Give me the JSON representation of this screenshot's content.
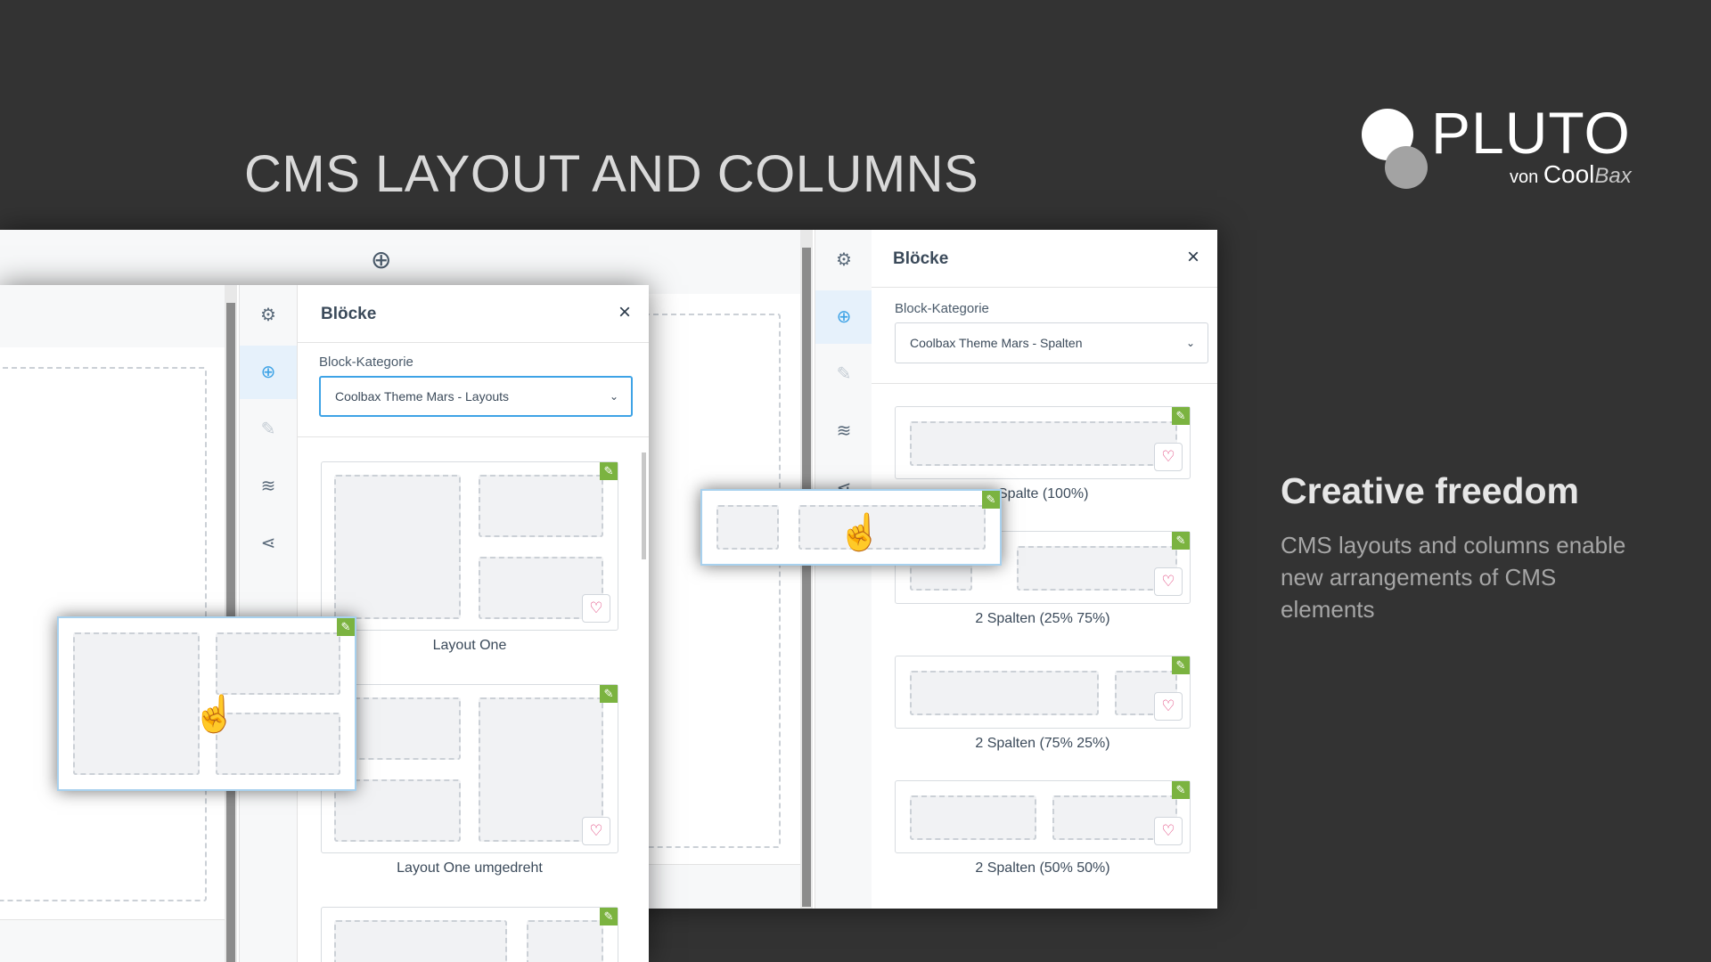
{
  "page": {
    "title": "CMS LAYOUT AND COLUMNS",
    "colors": {
      "background": "#333333",
      "accent": "#3ea3e6",
      "edit_badge": "#7bb340",
      "heart": "#e0407a"
    }
  },
  "logo": {
    "word": "PLUTO",
    "von": "von",
    "cool": "Cool",
    "bax": "Bax"
  },
  "promo": {
    "title": "Creative freedom",
    "body": "CMS layouts and columns enable new arrangements of CMS elements"
  },
  "back_panel": {
    "title": "Blöcke",
    "close_icon": "×",
    "category_label": "Block-Kategorie",
    "category_value": "Coolbax Theme Mars - Spalten",
    "add_icon": "⊕",
    "blocks": [
      {
        "label": "1 Spalte (100%)"
      },
      {
        "label": "2 Spalten (25% 75%)"
      },
      {
        "label": "2 Spalten (75% 25%)"
      },
      {
        "label": "2 Spalten (50% 50%)"
      }
    ],
    "visible_fragment": "Spalte (100%)"
  },
  "front_panel": {
    "title": "Blöcke",
    "close_icon": "×",
    "category_label": "Block-Kategorie",
    "category_value": "Coolbax Theme Mars - Layouts",
    "blocks": [
      {
        "label": "Layout One"
      },
      {
        "label": "Layout One umgedreht"
      },
      {
        "label": ""
      }
    ]
  },
  "icons": {
    "settings": "⚙",
    "add": "⊕",
    "edit": "✎",
    "layers": "≋",
    "share": "⋖",
    "heart": "♡",
    "chevron": "⌄",
    "pencil": "✎",
    "hand_cursor": "☝"
  }
}
